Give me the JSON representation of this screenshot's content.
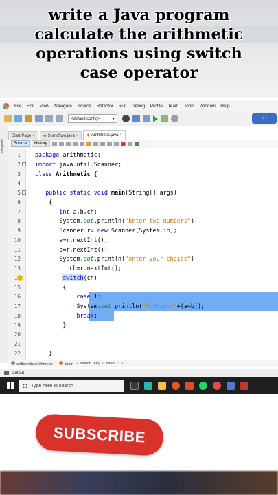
{
  "title": {
    "lines": [
      "write a Java program",
      "calculate the arithmetic",
      "operations using switch",
      "case operator"
    ]
  },
  "menubar": {
    "items": [
      "File",
      "Edit",
      "View",
      "Navigate",
      "Source",
      "Refactor",
      "Run",
      "Debug",
      "Profile",
      "Team",
      "Tools",
      "Window",
      "Help"
    ]
  },
  "toolbar": {
    "config_value": "<default config>"
  },
  "left_rail": {
    "label": "Projects"
  },
  "tabs": [
    {
      "label": "Start Page"
    },
    {
      "label": "Sumoftwo.java"
    },
    {
      "label": "Arithmetic.java"
    }
  ],
  "subbar": {
    "source_label": "Source",
    "history_label": "History"
  },
  "code": {
    "lines": [
      {
        "n": "1",
        "text": "package arithmetic;"
      },
      {
        "n": "2",
        "text": "import java.util.Scanner;"
      },
      {
        "n": "3",
        "text": "class Arithmetic {"
      },
      {
        "n": "4",
        "text": ""
      },
      {
        "n": "5",
        "text": "   public static void main(String[] args)"
      },
      {
        "n": "6",
        "text": "    {"
      },
      {
        "n": "7",
        "text": "       int a,b,ch;"
      },
      {
        "n": "8",
        "text": "       System.out.println(\"Enter two numbers\");"
      },
      {
        "n": "9",
        "text": "       Scanner r= new Scanner(System.in);"
      },
      {
        "n": "10",
        "text": "       a=r.nextInt();"
      },
      {
        "n": "11",
        "text": "       b=r.nextInt();"
      },
      {
        "n": "12",
        "text": "       System.out.println(\"enter your choice\");"
      },
      {
        "n": "13",
        "text": "          ch=r.nextInt();"
      },
      {
        "n": "14",
        "text": "        switch(ch)"
      },
      {
        "n": "15",
        "text": "        {"
      },
      {
        "n": "16",
        "text": "            case 1:"
      },
      {
        "n": "17",
        "text": "            System.out.println(\"Addtion=\"+(a+b));"
      },
      {
        "n": "18",
        "text": "            break;"
      },
      {
        "n": "19",
        "text": "        }"
      },
      {
        "n": "20",
        "text": ""
      },
      {
        "n": "21",
        "text": ""
      },
      {
        "n": "22",
        "text": "    }"
      }
    ]
  },
  "breadcrumbs": [
    "arithmetic.Arithmetic",
    "main",
    "switch (ch)",
    "case 1:"
  ],
  "output_label": "Output",
  "taskbar": {
    "search_placeholder": "Type here to search"
  },
  "subscribe": {
    "label": "SUBSCRIBE"
  },
  "colors": {
    "selection": "#5ea1f0",
    "keyword": "#0000e6",
    "string": "#ce7b00",
    "subscribe": "#d8322b"
  }
}
